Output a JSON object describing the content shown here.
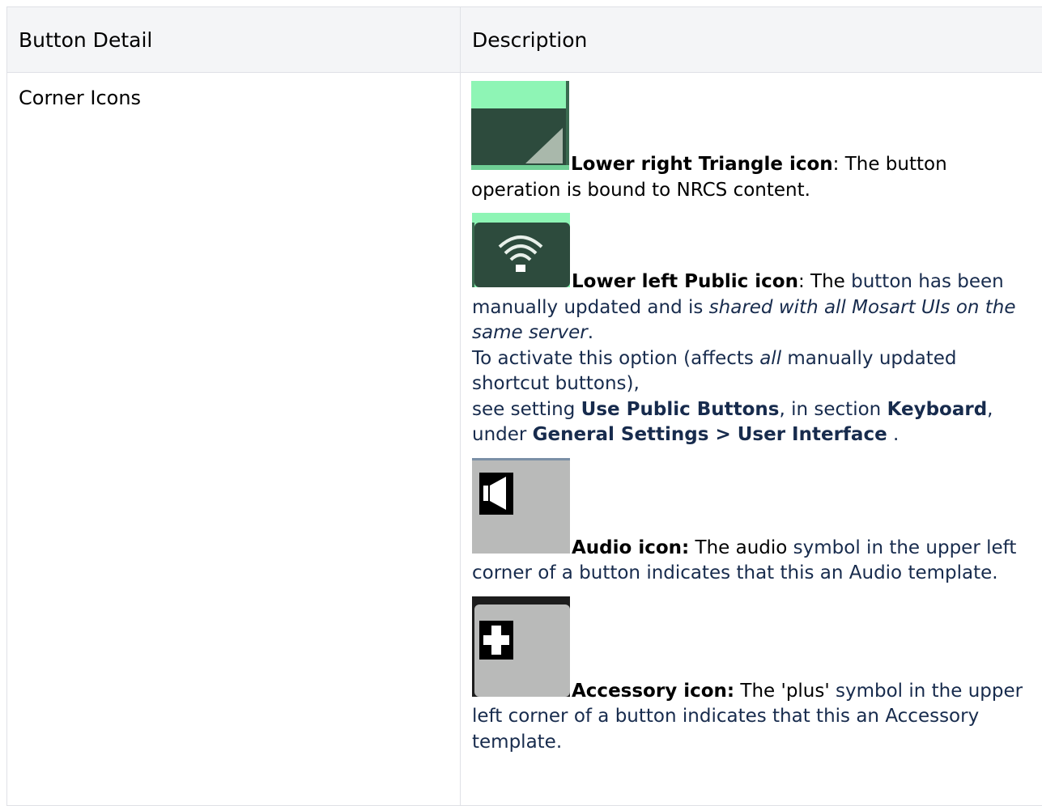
{
  "table": {
    "headers": [
      "Button Detail",
      "Description"
    ],
    "row": {
      "detail": "Corner Icons",
      "entries": {
        "triangle": {
          "title": "Lower right Triangle icon",
          "colon": ": The button",
          "text": "operation is bound to NRCS content."
        },
        "public": {
          "title": "Lower left Public icon",
          "colon": ": The",
          "text_a": " button has been manually updated and is ",
          "text_em": "shared with all Mosart UIs on the same server",
          "text_b": ".",
          "line2_a": "To activate this option (affects ",
          "line2_em": "all",
          "line2_b": " manually updated shortcut buttons),",
          "line3_a": "see setting ",
          "line3_setting": "Use Public Buttons",
          "line3_b": ", in section ",
          "line3_section": "Keyboard",
          "line3_c": ",",
          "line4_a": "under ",
          "line4_path": "General Settings > User Interface",
          "line4_b": " ."
        },
        "audio": {
          "title": "Audio icon:",
          "text_black": " The audio",
          "text": " symbol in the upper left corner of a button indicates that this an Audio template."
        },
        "accessory": {
          "title": "Accessory icon:",
          "text_black": " The 'plus'",
          "text": " symbol in the upper left corner of a button indicates that this an Accessory template."
        }
      }
    }
  },
  "icons": {
    "triangle": "nrcs-triangle-icon",
    "public": "public-wifi-icon",
    "audio": "audio-speaker-icon",
    "accessory": "accessory-plus-icon"
  },
  "colors": {
    "green_light": "#8ef5b5",
    "green_dark": "#2d4b3d",
    "grey_button": "#b9bab9",
    "text_navy": "#172b4d"
  }
}
